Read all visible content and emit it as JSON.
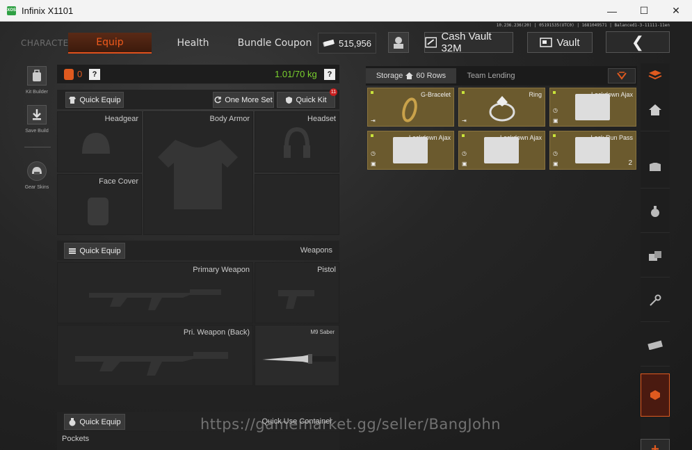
{
  "window": {
    "title": "Infinix X1101",
    "app_icon_text": "XOS",
    "minimize": "—",
    "maximize": "☐",
    "close": "✕"
  },
  "server_info": "10.236.236(20) | 05191535(UTC0) | 1681049571 | Balanced1-3-11111-11en",
  "nav": {
    "character": "CHARACTER",
    "equip": "Equip",
    "health": "Health",
    "bundle": "Bundle Coupon",
    "currency_amount": "515,956",
    "cash_vault": "Cash Vault 32M",
    "vault": "Vault",
    "back_icon": "❮"
  },
  "leftbar": {
    "kit_builder": "Kit Builder",
    "save_build": "Save Build",
    "gear_skins": "Gear Skins"
  },
  "status": {
    "vest_count": "0",
    "help": "?",
    "weight": "1.01/70 kg"
  },
  "gear": {
    "quick_equip": "Quick Equip",
    "one_more_set": "One More Set",
    "quick_kit": "Quick Kit",
    "quick_kit_badge": "11",
    "headgear": "Headgear",
    "body_armor": "Body Armor",
    "headset": "Headset",
    "face_cover": "Face Cover"
  },
  "weapons": {
    "quick_equip": "Quick Equip",
    "section": "Weapons",
    "primary": "Primary Weapon",
    "pistol": "Pistol",
    "primary_back": "Pri. Weapon (Back)",
    "melee": "M9 Saber"
  },
  "container": {
    "quick_equip": "Quick Equip",
    "section": "Quick Use Container",
    "pockets": "Pockets"
  },
  "storage": {
    "tab_storage": "Storage",
    "rows": "60 Rows",
    "tab_team": "Team Lending",
    "items": [
      {
        "name": "G-Bracelet",
        "count": ""
      },
      {
        "name": "Ring",
        "count": ""
      },
      {
        "name": "Lockdown Ajax",
        "count": ""
      },
      {
        "name": "Lockdown Ajax",
        "count": ""
      },
      {
        "name": "Lockdown Ajax",
        "count": ""
      },
      {
        "name": "Lock Run Pass",
        "count": "2"
      }
    ]
  },
  "watermark": "https://gamemarket.gg/seller/BangJohn",
  "accent_color": "#e05a1f",
  "weight_color": "#7ad12e"
}
